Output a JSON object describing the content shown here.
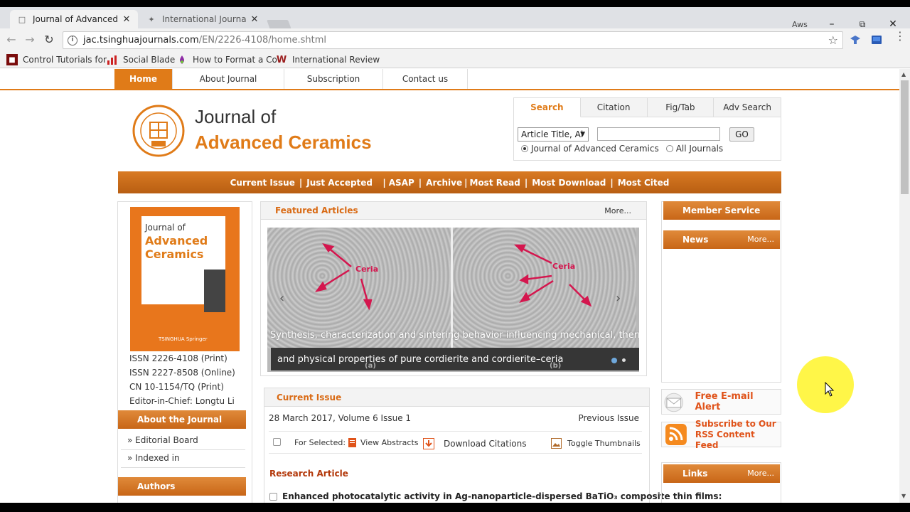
{
  "browser": {
    "tabs": [
      {
        "title": "Journal of Advanced Ce",
        "active": true
      },
      {
        "title": "International Journal of E",
        "active": false
      }
    ],
    "user_label": "Aws",
    "url_host": "jac.tsinghuajournals.com",
    "url_path": "/EN/2226-4108/home.shtml",
    "bookmarks": [
      {
        "label": "Control Tutorials for",
        "icon": "bookmark-ct-icon"
      },
      {
        "label": "Social Blade",
        "icon": "bar-chart-icon"
      },
      {
        "label": "How to Format a Co",
        "icon": "drop-icon"
      },
      {
        "label": "International Review",
        "icon": "w-logo-icon"
      }
    ]
  },
  "site": {
    "nav": [
      "Home",
      "About Journal",
      "Subscription",
      "Contact us"
    ],
    "journal_title_line1": "Journal of",
    "journal_title_line2": "Advanced Ceramics",
    "search": {
      "tabs": [
        "Search",
        "Citation",
        "Fig/Tab",
        "Adv Search"
      ],
      "select_value": "Article Title, Al",
      "go_label": "GO",
      "radio_this": "Journal of Advanced Ceramics",
      "radio_all": "All Journals"
    },
    "subnav": [
      "Current Issue",
      "Just Accepted",
      "ASAP",
      "Archive",
      "Most Read",
      "Most Download",
      "Most Cited"
    ]
  },
  "left": {
    "cover": {
      "line1": "Journal of",
      "line2": "Advanced",
      "line3": "Ceramics",
      "publishers": "TSINGHUA  Springer"
    },
    "issn_print": "ISSN 2226-4108 (Print)",
    "issn_online": "ISSN 2227-8508 (Online)",
    "cn": "CN 10-1154/TQ (Print)",
    "editor": "Editor-in-Chief: Longtu Li",
    "about_head": "About the Journal",
    "links": [
      "» Editorial Board",
      "» Indexed in"
    ],
    "authors_head": "Authors"
  },
  "featured": {
    "title": "Featured Articles",
    "more": "More...",
    "ceria_label": "Ceria",
    "caption_line1": "Synthesis, characterization and sintering behavior influencing mechanical, thermal",
    "caption_line2": "and physical properties of pure cordierite and cordierite–ceria",
    "sub_a": "(a)",
    "sub_b": "(b)"
  },
  "current": {
    "title": "Current Issue",
    "date": "28 March 2017, Volume 6 Issue 1",
    "previous": "Previous Issue",
    "for_selected": "For Selected:",
    "view_abstracts": "View Abstracts",
    "download_citations": "Download Citations",
    "toggle_thumbnails": "Toggle Thumbnails",
    "section": "Research Article",
    "first_article": "Enhanced photocatalytic activity in Ag-nanoparticle-dispersed BaTiO₃ composite thin films:"
  },
  "right": {
    "member_service": "Member Service",
    "news": "News",
    "news_more": "More...",
    "email_alert": "Free E-mail Alert",
    "rss_line1": "Subscribe to Our",
    "rss_line2": "RSS Content Feed",
    "links": "Links",
    "links_more": "More..."
  }
}
